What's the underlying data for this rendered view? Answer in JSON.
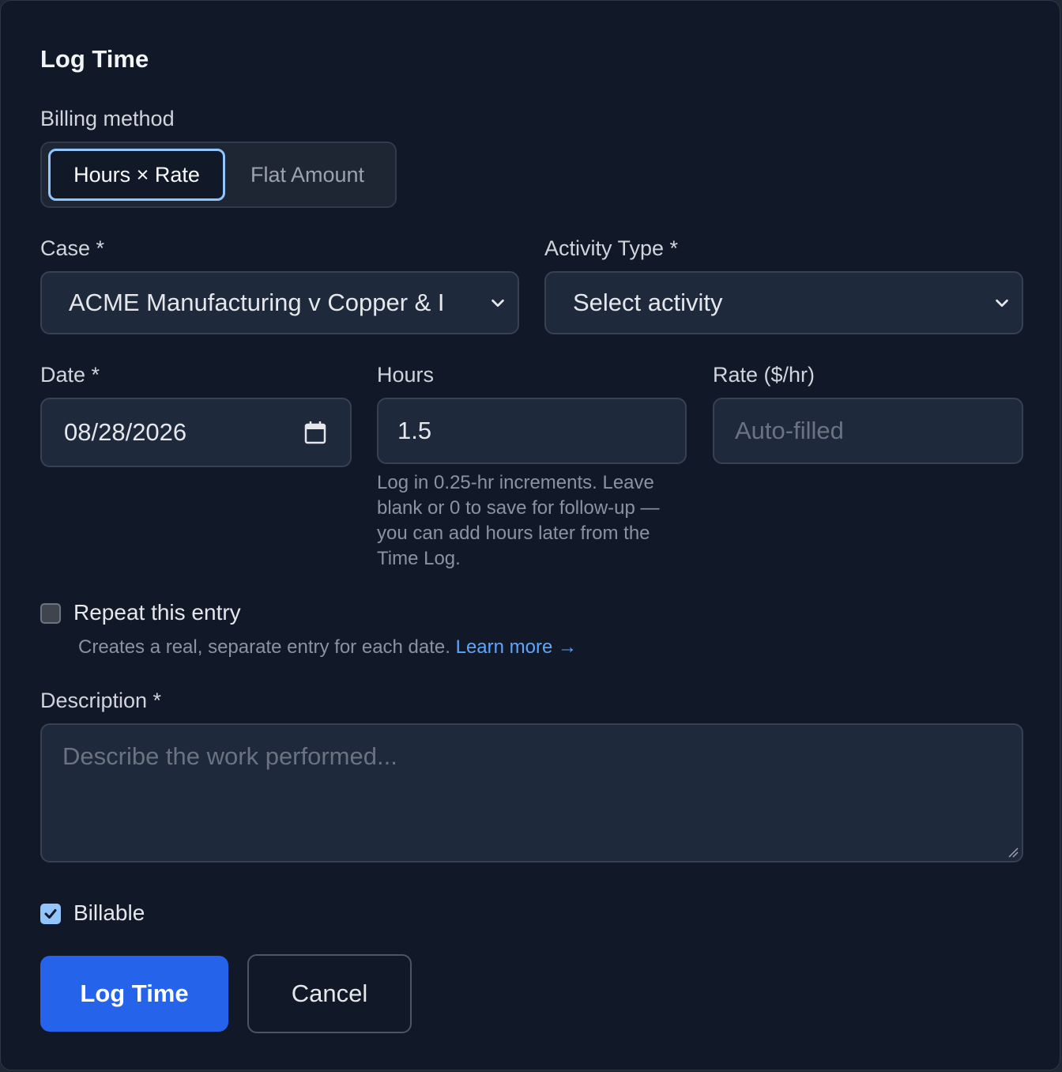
{
  "dialog": {
    "title": "Log Time"
  },
  "billing": {
    "label": "Billing method",
    "options": [
      {
        "label": "Hours × Rate",
        "selected": true
      },
      {
        "label": "Flat Amount",
        "selected": false
      }
    ]
  },
  "case": {
    "label": "Case *",
    "value": "ACME Manufacturing v Copper & I"
  },
  "activity": {
    "label": "Activity Type *",
    "value": "Select activity"
  },
  "date": {
    "label": "Date *",
    "value": "08/28/2026"
  },
  "hours": {
    "label": "Hours",
    "value": "1.5",
    "helper": [
      "Log in 0.25-hr increments. Leave",
      "blank or 0 to save for follow-up —",
      "you can add hours later from the",
      "Time Log."
    ]
  },
  "rate": {
    "label": "Rate ($/hr)",
    "placeholder": "Auto-filled"
  },
  "repeat": {
    "label": "Repeat this entry",
    "checked": false,
    "helper": "Creates a real, separate entry for each date.",
    "link": "Learn more →"
  },
  "description": {
    "label": "Description *",
    "placeholder": "Describe the work performed..."
  },
  "billable": {
    "label": "Billable",
    "checked": true
  },
  "actions": {
    "submit": "Log Time",
    "cancel": "Cancel"
  },
  "colors": {
    "accent": "#2563eb",
    "focus": "#93c5fd",
    "link": "#60a5fa",
    "background": "#111827"
  },
  "icons": {
    "select": "chevron-down-icon",
    "date": "calendar-icon",
    "check": "check-icon"
  }
}
